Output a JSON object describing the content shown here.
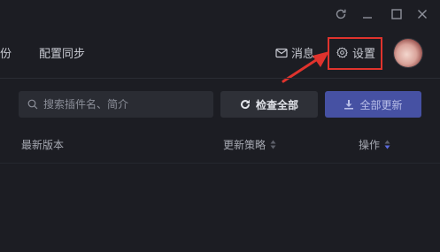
{
  "window_controls": {
    "refresh_icon": "refresh-icon",
    "minimize_icon": "minimize-icon",
    "maximize_icon": "maximize-icon",
    "close_icon": "close-icon"
  },
  "nav": {
    "tabs": [
      {
        "label": "份"
      },
      {
        "label": "配置同步"
      }
    ],
    "messages_label": "消息",
    "settings_label": "设置"
  },
  "toolbar": {
    "search_placeholder": "搜索插件名、简介",
    "check_all_label": "检查全部",
    "update_all_label": "全部更新"
  },
  "table": {
    "headers": {
      "latest_version": "最新版本",
      "update_policy": "更新策略",
      "actions": "操作"
    }
  },
  "colors": {
    "background": "#1c1d23",
    "primary_button": "#4651a3",
    "highlight_annotation": "#e0332d",
    "sort_active": "#5b6be0"
  }
}
